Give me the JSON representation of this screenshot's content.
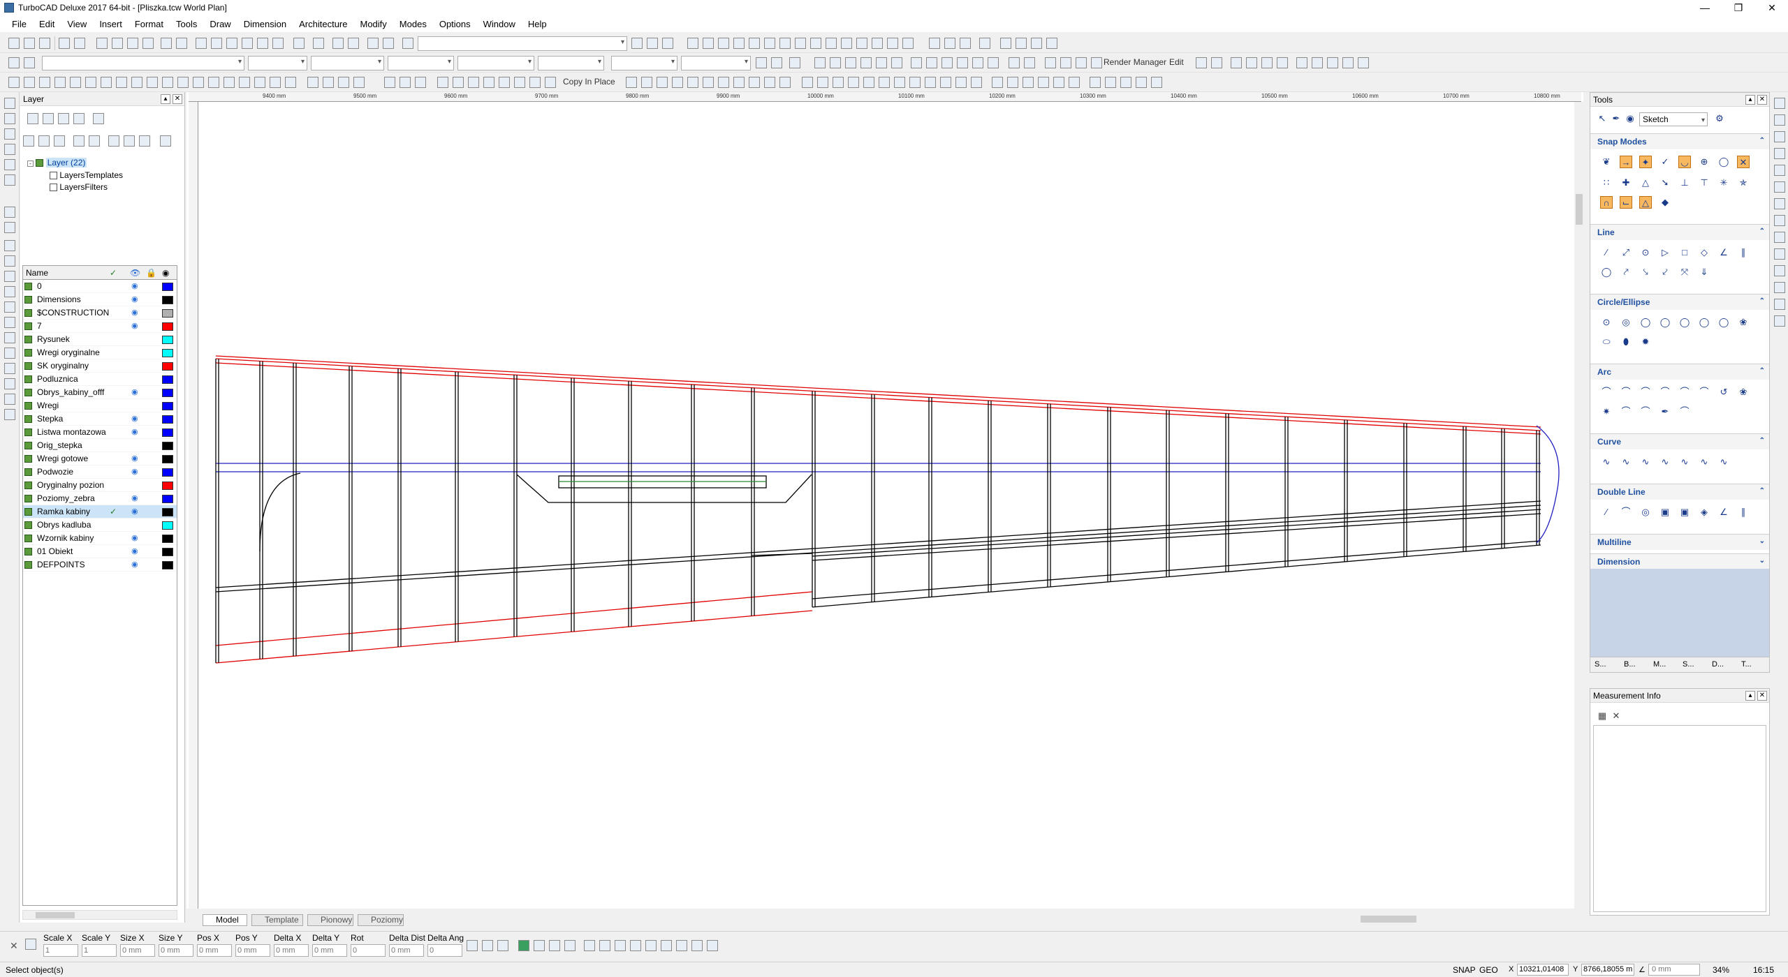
{
  "window": {
    "title": "TurboCAD Deluxe 2017 64-bit - [Pliszka.tcw World Plan]"
  },
  "menu": [
    "File",
    "Edit",
    "View",
    "Insert",
    "Format",
    "Tools",
    "Draw",
    "Dimension",
    "Architecture",
    "Modify",
    "Modes",
    "Options",
    "Window",
    "Help"
  ],
  "toolbar": {
    "render_manager": "Render Manager",
    "edit": "Edit",
    "copy_in_place": "Copy In Place"
  },
  "layer_panel": {
    "title": "Layer",
    "tree": {
      "root": "Layer (22)",
      "children": [
        "LayersTemplates",
        "LayersFilters"
      ]
    },
    "column_name": "Name",
    "rows": [
      {
        "name": "0",
        "visible": true,
        "active": false,
        "color": "#0000ff"
      },
      {
        "name": "Dimensions",
        "visible": true,
        "active": false,
        "color": "#000000"
      },
      {
        "name": "$CONSTRUCTION",
        "visible": true,
        "active": false,
        "color": "#b0b0b0"
      },
      {
        "name": "7",
        "visible": true,
        "active": false,
        "color": "#ff0000"
      },
      {
        "name": "Rysunek",
        "visible": false,
        "active": false,
        "color": "#00ffff"
      },
      {
        "name": "Wregi oryginalne",
        "visible": false,
        "active": false,
        "color": "#00ffff"
      },
      {
        "name": "SK oryginalny",
        "visible": false,
        "active": false,
        "color": "#ff0000"
      },
      {
        "name": "Podluznica",
        "visible": false,
        "active": false,
        "color": "#0000ff"
      },
      {
        "name": "Obrys_kabiny_offf",
        "visible": true,
        "active": false,
        "color": "#0000ff"
      },
      {
        "name": "Wregi",
        "visible": false,
        "active": false,
        "color": "#0000ff"
      },
      {
        "name": "Stepka",
        "visible": true,
        "active": false,
        "color": "#0000ff"
      },
      {
        "name": "Listwa montazowa",
        "visible": true,
        "active": false,
        "color": "#0000ff"
      },
      {
        "name": "Orig_stepka",
        "visible": false,
        "active": false,
        "color": "#000000"
      },
      {
        "name": "Wregi gotowe",
        "visible": true,
        "active": false,
        "color": "#000000"
      },
      {
        "name": "Podwozie",
        "visible": true,
        "active": false,
        "color": "#0000ff"
      },
      {
        "name": "Oryginalny pozion",
        "visible": false,
        "active": false,
        "color": "#ff0000"
      },
      {
        "name": "Poziomy_zebra",
        "visible": true,
        "active": false,
        "color": "#0000ff"
      },
      {
        "name": "Ramka kabiny",
        "visible": true,
        "active": true,
        "color": "#000000"
      },
      {
        "name": "Obrys kadluba",
        "visible": false,
        "active": false,
        "color": "#00ffff"
      },
      {
        "name": "Wzornik kabiny",
        "visible": true,
        "active": false,
        "color": "#000000"
      },
      {
        "name": "01 Obiekt",
        "visible": true,
        "active": false,
        "color": "#000000"
      },
      {
        "name": "DEFPOINTS",
        "visible": true,
        "active": false,
        "color": "#000000"
      }
    ]
  },
  "rulers": {
    "top": [
      "9400 mm",
      "9500 mm",
      "9600 mm",
      "9700 mm",
      "9800 mm",
      "9900 mm",
      "10000 mm",
      "10100 mm",
      "10200 mm",
      "10300 mm",
      "10400 mm",
      "10500 mm",
      "10600 mm",
      "10700 mm",
      "10800 mm"
    ]
  },
  "tabs": [
    "Model",
    "Template",
    "Pionowy",
    "Poziomy"
  ],
  "tools_panel": {
    "title": "Tools",
    "mode": "Sketch",
    "sections": [
      "Snap Modes",
      "Line",
      "Circle/Ellipse",
      "Arc",
      "Curve",
      "Double Line",
      "Multiline",
      "Dimension"
    ],
    "bottom_tabs": [
      "S...",
      "B...",
      "M...",
      "S...",
      "D...",
      "T..."
    ]
  },
  "measurement_panel": {
    "title": "Measurement Info"
  },
  "inspector": {
    "fields": [
      {
        "label": "Scale X",
        "value": "1"
      },
      {
        "label": "Scale Y",
        "value": "1"
      },
      {
        "label": "Size X",
        "value": "0 mm"
      },
      {
        "label": "Size Y",
        "value": "0 mm"
      },
      {
        "label": "Pos X",
        "value": "0 mm"
      },
      {
        "label": "Pos Y",
        "value": "0 mm"
      },
      {
        "label": "Delta X",
        "value": "0 mm"
      },
      {
        "label": "Delta Y",
        "value": "0 mm"
      },
      {
        "label": "Rot",
        "value": "0"
      },
      {
        "label": "Delta Dist",
        "value": "0 mm"
      },
      {
        "label": "Delta Ang",
        "value": "0"
      }
    ]
  },
  "status": {
    "message": "Select object(s)",
    "snap": "SNAP",
    "geo": "GEO",
    "coord_x": "10321,01408",
    "coord_y": "8766,18055 m",
    "dist": "0 mm",
    "zoom": "34%",
    "time": "16:15"
  },
  "colors": {
    "accent_orange": "#f8b860",
    "panel_blue": "#2050a0",
    "drawing_red": "#e00000",
    "drawing_blue": "#2020c0"
  }
}
